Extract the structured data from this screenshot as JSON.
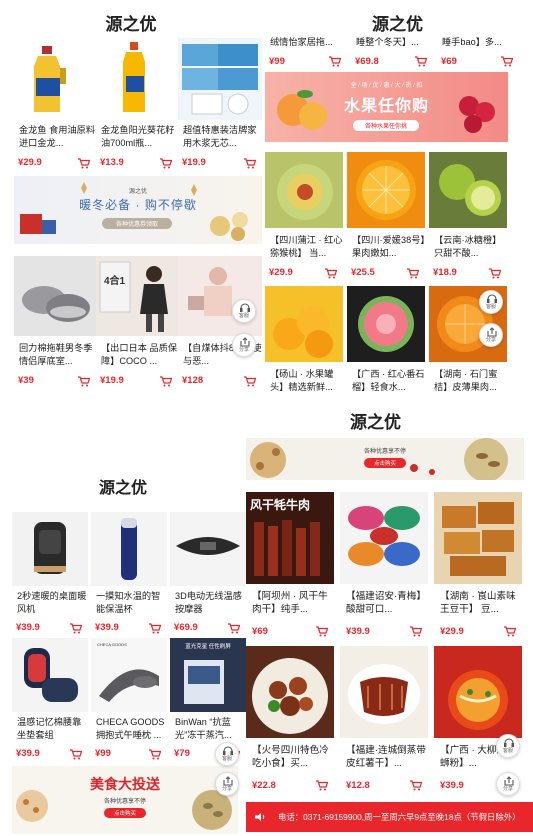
{
  "panel1": {
    "brand": "源之优",
    "row1": [
      {
        "title": "金龙鱼 食用油原料进口金龙...",
        "price": "¥29.9"
      },
      {
        "title": "金龙鱼阳光葵花籽油700ml瓶...",
        "price": "¥13.9"
      },
      {
        "title": "超值特惠装洁牌家用木浆无芯...",
        "price": "¥19.9"
      }
    ],
    "banner": {
      "small": "源之优",
      "main": "暖冬必备 · 购不停歇",
      "sub": "各种优惠券领取"
    },
    "row2": [
      {
        "title": "回力棉拖鞋男冬季情侣厚底室...",
        "price": "¥39"
      },
      {
        "title": "【出口日本 品质保障】COCO ...",
        "price": "¥19.9",
        "overlay": "4合1"
      },
      {
        "title": "【自煤体抖8】天使与恶...",
        "price": "¥128"
      }
    ]
  },
  "panel2": {
    "brand": "源之优",
    "row0": [
      {
        "title": "绒情怡家居拖...",
        "price": "¥99"
      },
      {
        "title": "睡整个冬天】...",
        "price": "¥69.8"
      },
      {
        "title": "睡手bao】多...",
        "price": "¥69"
      }
    ],
    "banner": {
      "small": "全 / 场 / 优 / 惠 / 大 / 折 / 扣",
      "main": "水果任你购",
      "sub": "各种水果任你挑"
    },
    "row1": [
      {
        "title": "【四川蒲江 · 红心猕猴桃】 当...",
        "price": "¥29.9"
      },
      {
        "title": "【四川·爱媛38号】果肉嫩如...",
        "price": "¥25.5"
      },
      {
        "title": "【云南·冰糖橙】只甜不酸...",
        "price": "¥18.9"
      }
    ],
    "row2": [
      {
        "title": "【砀山 · 水果罐头】精选新鲜...",
        "price": "¥39.9"
      },
      {
        "title": "【广西 · 红心番石榴】轻食水...",
        "price": "¥39.9"
      },
      {
        "title": "【湖南 · 石门蜜桔】皮薄果肉...",
        "price": "¥29.9"
      }
    ]
  },
  "panel3": {
    "brand": "源之优",
    "row1": [
      {
        "title": "2秒速暖的桌面暖风机",
        "price": "¥39.9"
      },
      {
        "title": "一摸知水温的智能保温杯",
        "price": "¥39.9"
      },
      {
        "title": "3D电动无线温感按摩器",
        "price": "¥69.9"
      }
    ],
    "row2": [
      {
        "title": "温感记忆棉腰靠坐垫套组",
        "price": "¥39.9"
      },
      {
        "title": "CHECA GOODS 拥抱式午睡枕 ...",
        "price": "¥99",
        "imgtext": "CHECA GOODS"
      },
      {
        "title": "BinWan “抗蓝光”冻干蒸汽...",
        "price": "¥79",
        "imgtext": "蓝光克星 任性刷屏"
      }
    ],
    "banner": {
      "main": "美食大投送",
      "sub": "各种优惠享不停",
      "btn": "点击购买"
    }
  },
  "panel4": {
    "brand": "源之优",
    "banner": {
      "sub": "各种优惠享不停",
      "btn": "点击购买"
    },
    "row1": [
      {
        "title": "【阿坝州 · 风干牛肉干】纯手...",
        "price": "¥69",
        "imgtext": "风干牦牛肉"
      },
      {
        "title": "【福建诏安·青梅】 酸甜可口...",
        "price": "¥39.9"
      },
      {
        "title": "【湖南 · 崀山素味王豆干】 豆...",
        "price": "¥29.9"
      }
    ],
    "row2": [
      {
        "title": "【火号四川特色冷吃小食】买...",
        "price": "¥22.8"
      },
      {
        "title": "【福建·连城倒蒸带皮红薯干】...",
        "price": "¥12.8"
      },
      {
        "title": "【广西 · 大柳州螺蛳粉】...",
        "price": "¥39.9"
      }
    ],
    "footer": "电话：0371-69159900,周一至周六早9点至晚18点（节假日除外）"
  },
  "float": {
    "service": "客服",
    "share": "分享"
  },
  "colors": {
    "price": "#e8262c",
    "footer_bg": "#e8262c"
  },
  "icons": [
    "cart-icon",
    "headset-icon",
    "share-icon",
    "speaker-icon"
  ]
}
